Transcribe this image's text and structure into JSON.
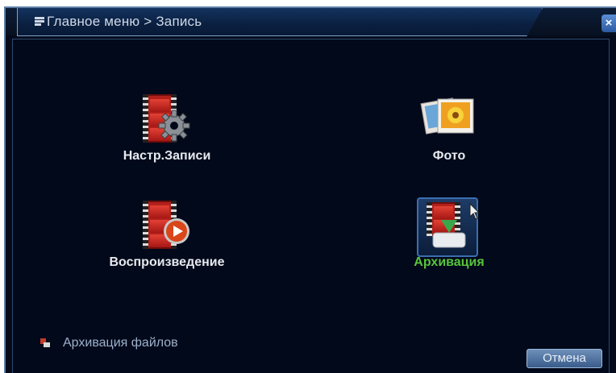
{
  "window": {
    "title": "Главное меню > Запись",
    "close_label": "×"
  },
  "tiles": [
    {
      "label": "Настр.Записи",
      "icon": "record-settings-icon",
      "selected": false
    },
    {
      "label": "Фото",
      "icon": "photo-icon",
      "selected": false
    },
    {
      "label": "Воспроизведение",
      "icon": "playback-icon",
      "selected": false
    },
    {
      "label": "Архивация",
      "icon": "archive-icon",
      "selected": true
    }
  ],
  "link": {
    "label": "Архивация файлов",
    "icon": "archive-files-icon"
  },
  "buttons": {
    "cancel_label": "Отмена"
  },
  "colors": {
    "background": "#02091a",
    "active_label": "#58c43a",
    "frame": "#5d7fa6"
  }
}
